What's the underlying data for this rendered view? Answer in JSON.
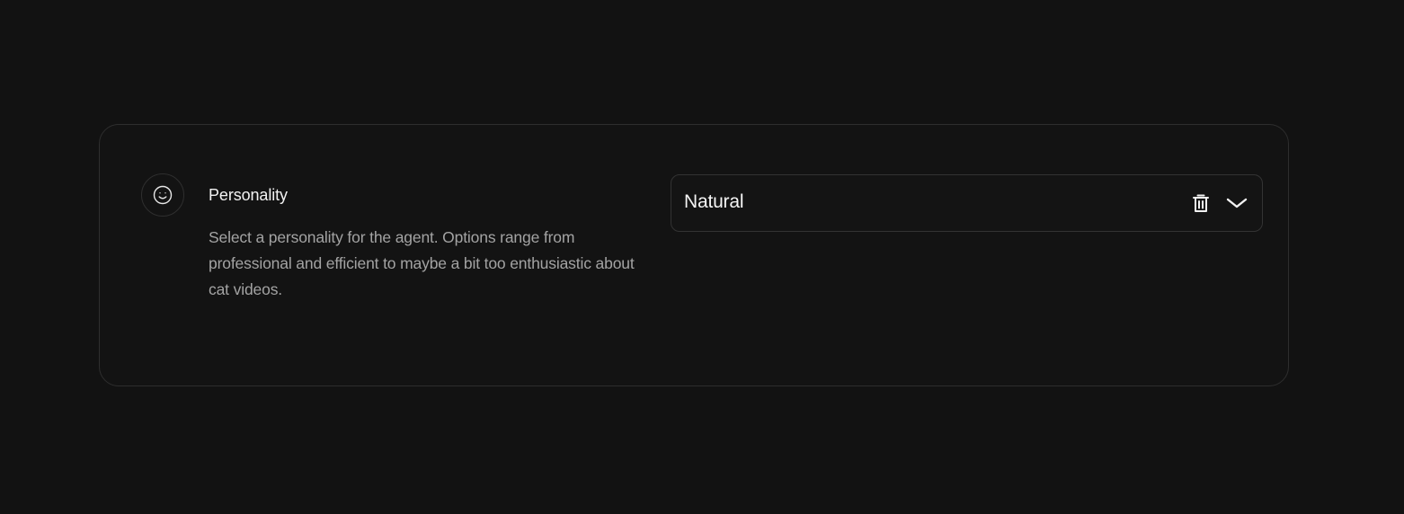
{
  "setting": {
    "title": "Personality",
    "description": "Select a personality for the agent. Options range from professional and efficient to maybe a bit too enthusiastic about cat videos.",
    "icon": "smiley-face-icon"
  },
  "select": {
    "value": "Natural",
    "clear_icon": "trash-icon",
    "expand_icon": "chevron-down-icon"
  },
  "colors": {
    "background": "#121212",
    "border": "#2e2e2e",
    "text_primary": "#f2f2f2",
    "text_secondary": "#a3a3a3"
  }
}
